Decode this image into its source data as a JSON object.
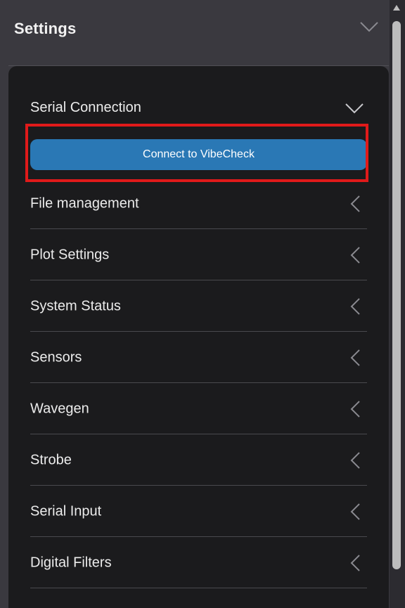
{
  "header": {
    "title": "Settings",
    "toggle_icon": "chevron-down-icon"
  },
  "serial_connection": {
    "label": "Serial Connection",
    "toggle_icon": "chevron-down-icon",
    "connect_button_label": "Connect to VibeCheck"
  },
  "sections": [
    {
      "label": "File management",
      "icon": "chevron-left-icon"
    },
    {
      "label": "Plot Settings",
      "icon": "chevron-left-icon"
    },
    {
      "label": "System Status",
      "icon": "chevron-left-icon"
    },
    {
      "label": "Sensors",
      "icon": "chevron-left-icon"
    },
    {
      "label": "Wavegen",
      "icon": "chevron-left-icon"
    },
    {
      "label": "Strobe",
      "icon": "chevron-left-icon"
    },
    {
      "label": "Serial Input",
      "icon": "chevron-left-icon"
    },
    {
      "label": "Digital Filters",
      "icon": "chevron-left-icon"
    }
  ],
  "colors": {
    "background": "#3a393f",
    "panel": "#1b1b1d",
    "accent_button": "#2a78b5",
    "highlight": "#e01a1a"
  }
}
